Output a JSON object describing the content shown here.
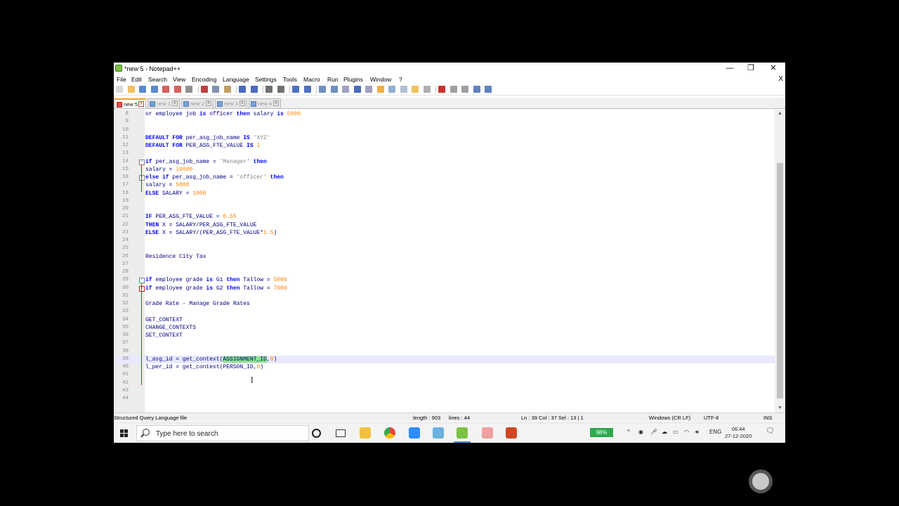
{
  "window": {
    "title": "*new 5 - Notepad++",
    "minimize": "—",
    "restore": "❐",
    "close": "✕"
  },
  "menu": {
    "items": [
      "File",
      "Edit",
      "Search",
      "View",
      "Encoding",
      "Language",
      "Settings",
      "Tools",
      "Macro",
      "Run",
      "Plugins",
      "Window",
      "?"
    ],
    "close_doc": "X"
  },
  "toolbar": {
    "icons": [
      "new-file-icon",
      "open-file-icon",
      "save-icon",
      "save-all-icon",
      "close-icon",
      "close-all-icon",
      "print-icon",
      "cut-icon",
      "copy-icon",
      "paste-icon",
      "undo-icon",
      "redo-icon",
      "find-icon",
      "replace-icon",
      "zoom-in-icon",
      "zoom-out-icon",
      "sync-vertical-icon",
      "sync-horizontal-icon",
      "word-wrap-icon",
      "show-all-chars-icon",
      "indent-guide-icon",
      "user-lang-icon",
      "doc-map-icon",
      "function-list-icon",
      "folder-workspace-icon",
      "monitoring-icon",
      "record-macro-icon",
      "stop-record-icon",
      "play-macro-icon",
      "run-macro-multiple-icon",
      "save-macro-icon"
    ]
  },
  "tabs": [
    {
      "label": "new 5",
      "active": true
    },
    {
      "label": "new 1",
      "active": false
    },
    {
      "label": "new 2",
      "active": false
    },
    {
      "label": "new 3",
      "active": false
    },
    {
      "label": "new 4",
      "active": false
    }
  ],
  "editor": {
    "current_line": 39,
    "lines": [
      {
        "n": "8",
        "fold": "",
        "html": "or employee job <span class=\"k\">is</span> officer <span class=\"k\">then</span> salary <span class=\"k\">is</span> <span class=\"n\">5000</span>"
      },
      {
        "n": "9",
        "fold": "",
        "html": ""
      },
      {
        "n": "10",
        "fold": "",
        "html": ""
      },
      {
        "n": "11",
        "fold": "",
        "html": "<span class=\"k\">DEFAULT FOR</span> per_asg_job_name <span class=\"k\">IS</span> <span class=\"s\">'XYZ'</span>"
      },
      {
        "n": "12",
        "fold": "",
        "html": "<span class=\"k\">DEFAULT FOR</span> PER_ASG_FTE_VALUE <span class=\"k\">IS</span> <span class=\"n\">1</span>"
      },
      {
        "n": "13",
        "fold": "",
        "html": ""
      },
      {
        "n": "14",
        "fold": "minus",
        "html": "<span class=\"k\">if</span> per_asg_job_name = <span class=\"s\">'Manager'</span> <span class=\"k\">then</span>"
      },
      {
        "n": "15",
        "fold": "",
        "html": "salary = <span class=\"n\">10000</span>"
      },
      {
        "n": "16",
        "fold": "minus",
        "html": "<span class=\"k\">else if</span> per_asg_job_name = <span class=\"s\">'officer'</span> <span class=\"k\">then</span>"
      },
      {
        "n": "17",
        "fold": "",
        "html": "salary = <span class=\"n\">5000</span>"
      },
      {
        "n": "18",
        "fold": "",
        "html": "<span class=\"k\">ELSE</span> SALARY = <span class=\"n\">1000</span>"
      },
      {
        "n": "19",
        "fold": "",
        "html": ""
      },
      {
        "n": "20",
        "fold": "",
        "html": ""
      },
      {
        "n": "21",
        "fold": "",
        "html": "<span class=\"k\">IF</span> PER_ASG_FTE_VALUE = <span class=\"n\">0.55</span>"
      },
      {
        "n": "22",
        "fold": "",
        "html": "<span class=\"k\">THEN</span> X = SALARY/PER_ASG_FTE_VALUE"
      },
      {
        "n": "23",
        "fold": "",
        "html": "<span class=\"k\">ELSE</span> X = SALARY/(PER_ASG_FTE_VALUE*<span class=\"n\">1.5</span>)"
      },
      {
        "n": "24",
        "fold": "",
        "html": ""
      },
      {
        "n": "25",
        "fold": "",
        "html": ""
      },
      {
        "n": "26",
        "fold": "",
        "html": "Residence City Tax"
      },
      {
        "n": "27",
        "fold": "",
        "html": ""
      },
      {
        "n": "28",
        "fold": "",
        "html": ""
      },
      {
        "n": "29",
        "fold": "minus",
        "html": "<span class=\"k\">if</span> employee grade <span class=\"k\">is</span> G1 <span class=\"k\">then</span> Tallow = <span class=\"n\">5000</span>"
      },
      {
        "n": "30",
        "fold": "red",
        "html": "<span class=\"k\">if</span> employee grade <span class=\"k\">is</span> G2 <span class=\"k\">then</span> Tallow = <span class=\"n\">7000</span>"
      },
      {
        "n": "31",
        "fold": "",
        "html": ""
      },
      {
        "n": "32",
        "fold": "",
        "html": "Grade Rate - Manage Grade Rates"
      },
      {
        "n": "33",
        "fold": "",
        "html": ""
      },
      {
        "n": "34",
        "fold": "",
        "html": "GET_CONTEXT"
      },
      {
        "n": "35",
        "fold": "",
        "html": "CHANGE_CONTEXTS"
      },
      {
        "n": "36",
        "fold": "",
        "html": "SET_CONTEXT"
      },
      {
        "n": "37",
        "fold": "",
        "html": ""
      },
      {
        "n": "38",
        "fold": "",
        "html": ""
      },
      {
        "n": "39",
        "fold": "",
        "html": "l_asg_id = get_context(<span class=\"sel\">ASSIGNMENT_ID</span>,<span class=\"n\">0</span>)"
      },
      {
        "n": "40",
        "fold": "",
        "html": "l_per_id = get_context(PERSON_ID,<span class=\"n\">0</span>)"
      },
      {
        "n": "41",
        "fold": "",
        "html": ""
      },
      {
        "n": "42",
        "fold": "",
        "html": ""
      },
      {
        "n": "43",
        "fold": "",
        "html": ""
      },
      {
        "n": "44",
        "fold": "",
        "html": ""
      }
    ]
  },
  "status": {
    "file_type": "Structured Query Language file",
    "length": "length : 903",
    "lines": "lines : 44",
    "position": "Ln : 39    Col : 37    Sel : 13 | 1",
    "eol": "Windows (CR LF)",
    "encoding": "UTF-8",
    "mode": "INS"
  },
  "taskbar": {
    "search_placeholder": "Type here to search",
    "battery": "98%",
    "language": "ENG",
    "time": "06:44",
    "date": "27-12-2020"
  },
  "colors": {
    "keyword": "#0000ff",
    "number": "#ff8000",
    "string": "#808080",
    "selection": "#8ce08c",
    "current_line": "#e8e8ff"
  }
}
